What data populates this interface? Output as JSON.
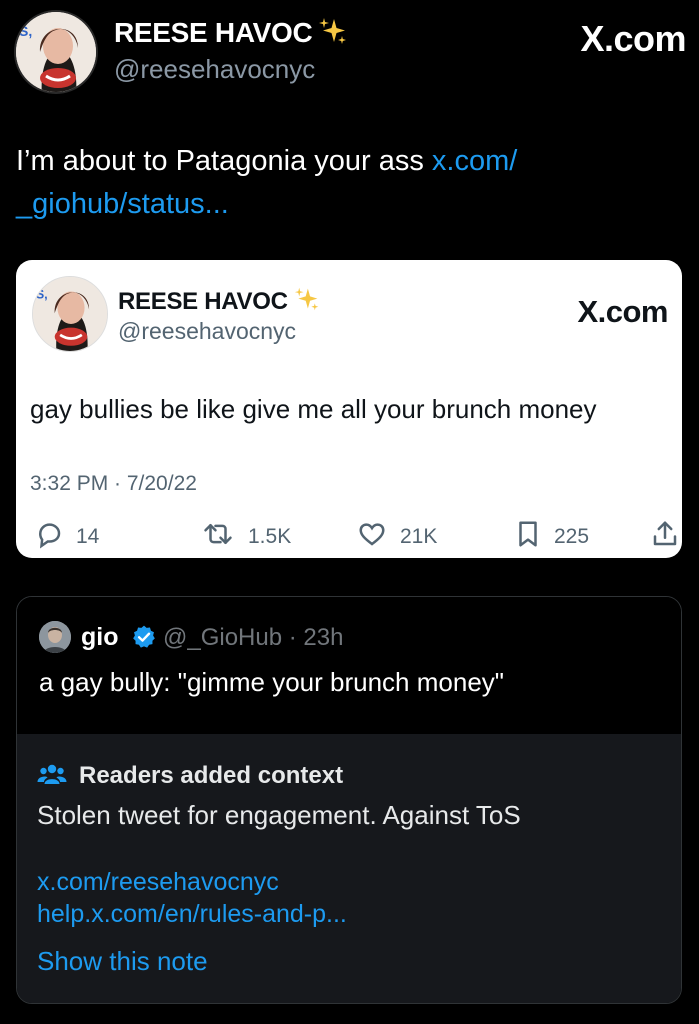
{
  "header": {
    "display_name": "REESE HAVOC",
    "handle": "@reesehavocnyc",
    "watermark": "X.com"
  },
  "main_tweet": {
    "text": "I’m about to Patagonia your ass ",
    "link_line1": "x.com/",
    "link_line2": "_giohub/status..."
  },
  "embedded_card": {
    "display_name": "REESE HAVOC",
    "handle": "@reesehavocnyc",
    "watermark": "X.com",
    "text": "gay bullies be like give me all your brunch money",
    "timestamp": "3:32 PM · 7/20/22",
    "stats": {
      "replies": "14",
      "retweets": "1.5K",
      "likes": "21K",
      "bookmarks": "225"
    }
  },
  "quoted_tweet": {
    "display_name": "gio",
    "handle": "@_GioHub",
    "time": "23h",
    "meta": "@_GioHub · 23h",
    "text": "a gay bully: \"gimme your brunch money\""
  },
  "community_note": {
    "title": "Readers added context",
    "body": "Stolen tweet for engagement. Against ToS",
    "link1": "x.com/reesehavocnyc",
    "link2": "help.x.com/en/rules-and-p...",
    "show_label": "Show this note"
  },
  "colors": {
    "background": "#000000",
    "link_blue": "#1d9bf0",
    "verified_blue": "#1d9bf0",
    "note_background": "#16181c",
    "card_background": "#ffffff"
  },
  "icons": [
    "sparkles-icon",
    "verified-badge-icon",
    "reply-icon",
    "retweet-icon",
    "like-icon",
    "bookmark-icon",
    "share-icon",
    "people-icon"
  ]
}
